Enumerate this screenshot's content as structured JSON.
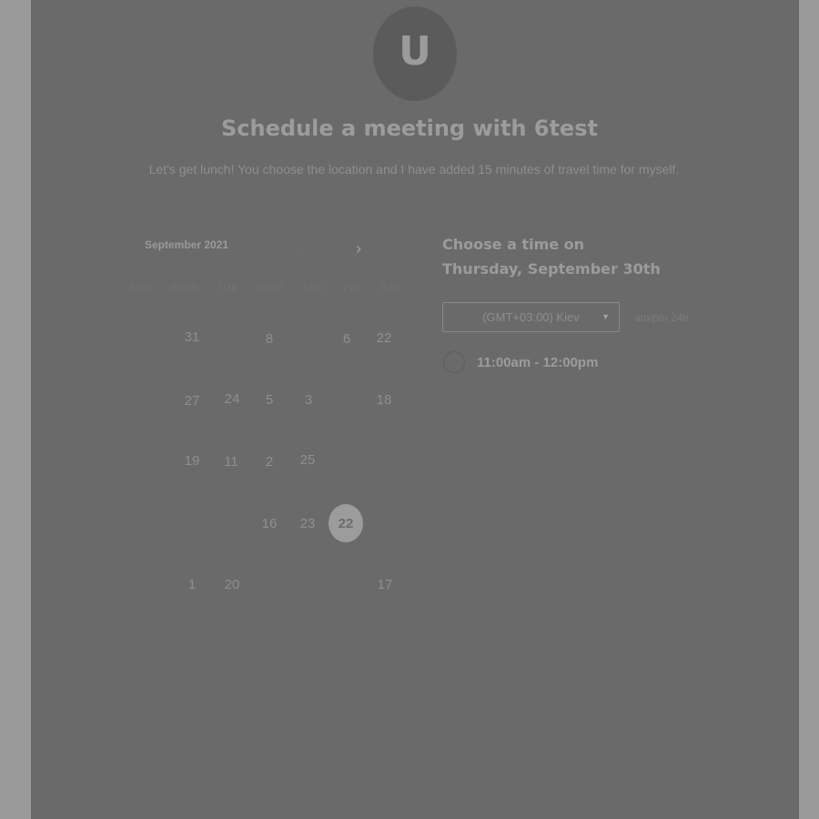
{
  "header": {
    "avatar_letter": "U",
    "title": "Schedule a meeting with 6test",
    "subtitle": "Let's get lunch! You choose the location and I have added 15 minutes of travel time for myself."
  },
  "calendar": {
    "month_label": "September 2021",
    "prev_icon": "chevron-left-icon",
    "next_icon": "chevron-right-icon",
    "weekdays": [
      "SUN",
      "MON",
      "TUE",
      "WED",
      "THU",
      "FRI",
      "SAT"
    ],
    "days": [
      "31",
      "8",
      "6",
      "22",
      "27",
      "24",
      "5",
      "3",
      "18",
      "19",
      "11",
      "2",
      "25",
      "16",
      "23",
      "22",
      "1",
      "20",
      "17"
    ],
    "selected_day": "22"
  },
  "timepicker": {
    "heading": "Choose a time on Thursday, September 30th",
    "timezone": "(GMT+03:00) Kiev",
    "format_ampm": "am/pm",
    "format_24h": "24h",
    "slots": [
      "11:00am - 12:00pm"
    ]
  },
  "colors": {
    "overlay": "#6a6a6a",
    "outer": "#9a9a9a"
  }
}
